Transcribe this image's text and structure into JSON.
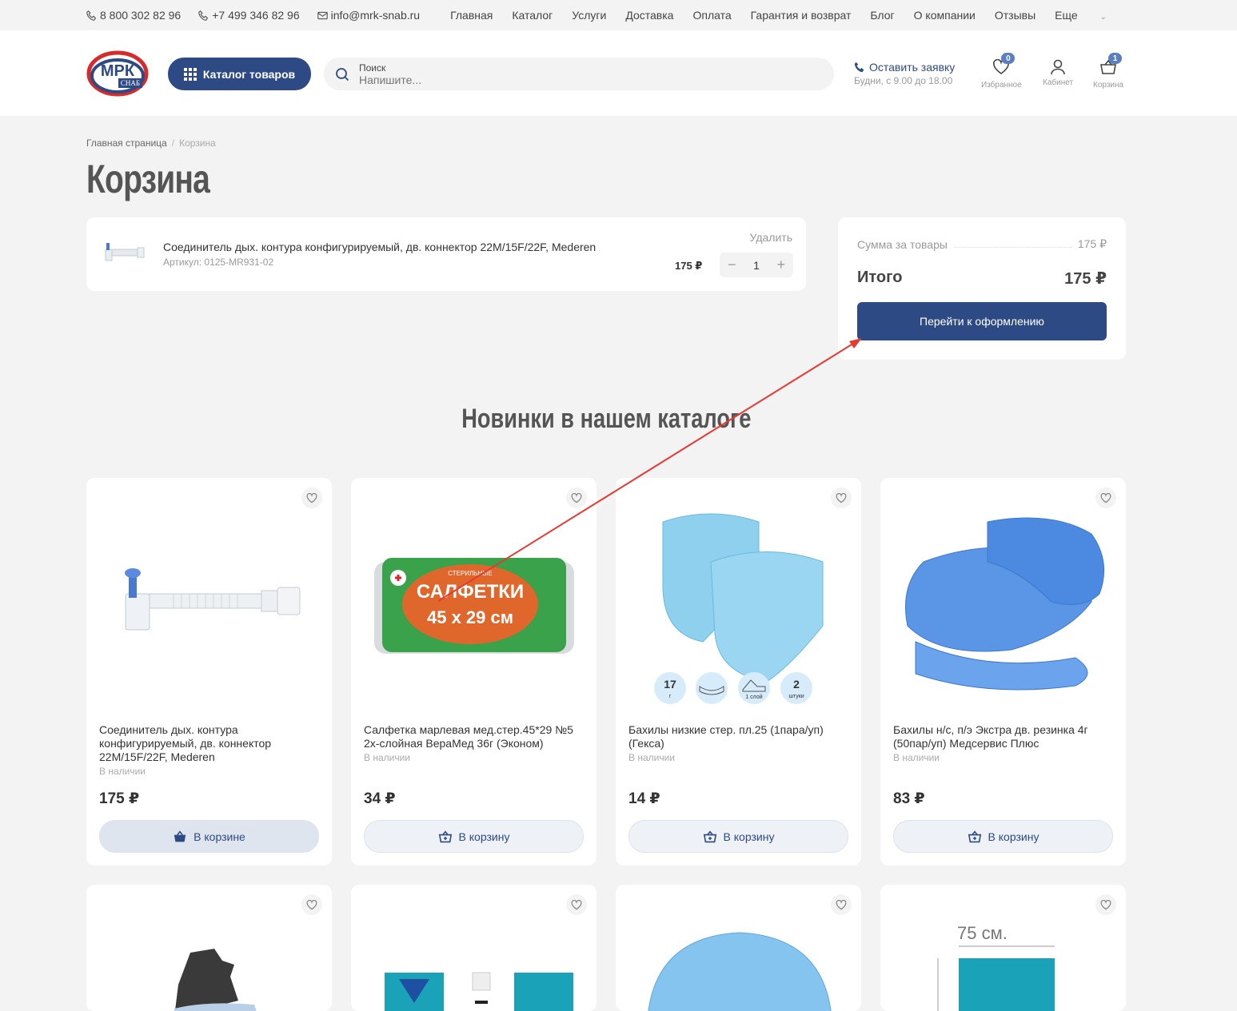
{
  "topbar": {
    "phone1": "8 800 302 82 96",
    "phone2": "+7 499 346 82 96",
    "email": "info@mrk-snab.ru",
    "nav": [
      "Главная",
      "Каталог",
      "Услуги",
      "Доставка",
      "Оплата",
      "Гарантия и возврат",
      "Блог",
      "О компании",
      "Отзывы",
      "Еще"
    ]
  },
  "header": {
    "logo_text": "МРК",
    "logo_sub": "СНАБ",
    "catalog_button": "Каталог товаров",
    "search_label": "Поиск",
    "search_placeholder": "Напишите...",
    "request_title": "Оставить заявку",
    "request_hours": "Будни, с 9.00 до 18.00",
    "favorites_label": "Избранное",
    "favorites_count": "0",
    "cabinet_label": "Кабинет",
    "cart_label": "Корзина",
    "cart_count": "1"
  },
  "breadcrumb": {
    "home": "Главная страница",
    "sep": "/",
    "current": "Корзина"
  },
  "page_title": "Корзина",
  "cart_item": {
    "name": "Соединитель дых. контура конфигурируемый, дв. коннектор 22M/15F/22F, Mederen",
    "sku": "Артикул: 0125-MR931-02",
    "remove": "Удалить",
    "price": "175 ₽",
    "qty": "1",
    "minus": "−",
    "plus": "+"
  },
  "summary": {
    "goods_label": "Сумма за товары",
    "goods_value": "175 ₽",
    "total_label": "Итого",
    "total_value": "175 ₽",
    "checkout": "Перейти к оформлению"
  },
  "section_title": "Новинки в нашем каталоге",
  "products": [
    {
      "name": "Соединитель дых. контура конфигурируемый, дв. коннектор 22M/15F/22F, Mederen",
      "stock": "В наличии",
      "price": "175 ₽",
      "button": "В корзине"
    },
    {
      "name": "Салфетка марлевая мед.стер.45*29 №5 2х-слойная ВераМед 36г (Эконом)",
      "stock": "В наличии",
      "price": "34 ₽",
      "button": "В корзину"
    },
    {
      "name": "Бахилы низкие стер. пл.25 (1пара/уп) (Гекса)",
      "stock": "В наличии",
      "price": "14 ₽",
      "button": "В корзину"
    },
    {
      "name": "Бахилы н/с, п/э Экстра дв. резинка 4г (50пар/уп) Медсервис Плюс",
      "stock": "В наличии",
      "price": "83 ₽",
      "button": "В корзину"
    }
  ],
  "product_image_text": {
    "napkin_top": "СТЕРИЛЬНЫЕ",
    "napkin_title": "САЛФЕТКИ",
    "napkin_size": "45 х 29 см",
    "badge1_num": "17",
    "badge1_unit": "г",
    "badge3_unit": "1 слой",
    "badge4_num": "2",
    "badge4_unit": "штуки",
    "size_label": "75 см."
  },
  "colors": {
    "brand": "#2e4a85",
    "bg": "#f3f3f3",
    "arrow": "#e8392f"
  }
}
